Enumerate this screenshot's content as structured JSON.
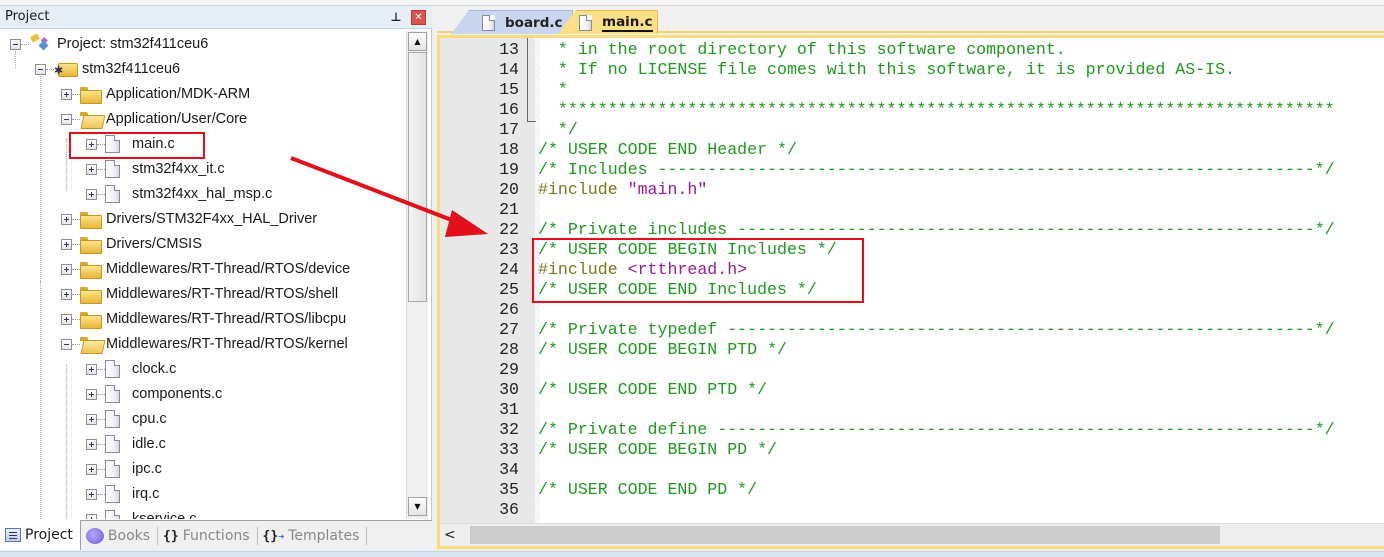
{
  "project_panel": {
    "title": "Project",
    "pin_icon": "pin-icon",
    "close_icon": "close-icon",
    "tree": [
      {
        "label": "Project: stm32f411ceu6",
        "level": 0,
        "type": "project",
        "expanded": true
      },
      {
        "label": "stm32f411ceu6",
        "level": 1,
        "type": "target",
        "expanded": true
      },
      {
        "label": "Application/MDK-ARM",
        "level": 2,
        "type": "folder",
        "expanded": false
      },
      {
        "label": "Application/User/Core",
        "level": 2,
        "type": "folder",
        "expanded": true
      },
      {
        "label": "main.c",
        "level": 3,
        "type": "file",
        "highlighted": true
      },
      {
        "label": "stm32f4xx_it.c",
        "level": 3,
        "type": "file"
      },
      {
        "label": "stm32f4xx_hal_msp.c",
        "level": 3,
        "type": "file"
      },
      {
        "label": "Drivers/STM32F4xx_HAL_Driver",
        "level": 2,
        "type": "folder",
        "expanded": false
      },
      {
        "label": "Drivers/CMSIS",
        "level": 2,
        "type": "folder",
        "expanded": false
      },
      {
        "label": "Middlewares/RT-Thread/RTOS/device",
        "level": 2,
        "type": "folder",
        "expanded": false
      },
      {
        "label": "Middlewares/RT-Thread/RTOS/shell",
        "level": 2,
        "type": "folder",
        "expanded": false
      },
      {
        "label": "Middlewares/RT-Thread/RTOS/libcpu",
        "level": 2,
        "type": "folder",
        "expanded": false
      },
      {
        "label": "Middlewares/RT-Thread/RTOS/kernel",
        "level": 2,
        "type": "folder",
        "expanded": true
      },
      {
        "label": "clock.c",
        "level": 3,
        "type": "file"
      },
      {
        "label": "components.c",
        "level": 3,
        "type": "file"
      },
      {
        "label": "cpu.c",
        "level": 3,
        "type": "file"
      },
      {
        "label": "idle.c",
        "level": 3,
        "type": "file"
      },
      {
        "label": "ipc.c",
        "level": 3,
        "type": "file"
      },
      {
        "label": "irq.c",
        "level": 3,
        "type": "file"
      },
      {
        "label": "kservice.c",
        "level": 3,
        "type": "file"
      }
    ],
    "tabs": [
      {
        "label": "Project",
        "icon": "project-icon",
        "active": true
      },
      {
        "label": "Books",
        "icon": "books-icon",
        "active": false
      },
      {
        "label": "Functions",
        "icon": "functions-icon",
        "active": false
      },
      {
        "label": "Templates",
        "icon": "templates-icon",
        "active": false
      }
    ]
  },
  "editor": {
    "tabs": [
      {
        "label": "board.c",
        "active": false
      },
      {
        "label": "main.c",
        "active": true
      }
    ],
    "lines": [
      {
        "n": "13",
        "parts": [
          {
            "t": "  * in the root directory of this software component.",
            "c": "cm"
          }
        ]
      },
      {
        "n": "14",
        "parts": [
          {
            "t": "  * If no LICENSE file comes with this software, it is provided AS-IS.",
            "c": "cm"
          }
        ]
      },
      {
        "n": "15",
        "parts": [
          {
            "t": "  *",
            "c": "cm"
          }
        ]
      },
      {
        "n": "16",
        "parts": [
          {
            "t": "  ******************************************************************************",
            "c": "cm"
          }
        ]
      },
      {
        "n": "17",
        "parts": [
          {
            "t": "  */",
            "c": "cm"
          }
        ]
      },
      {
        "n": "18",
        "parts": [
          {
            "t": "/* USER CODE END Header */",
            "c": "cm"
          }
        ]
      },
      {
        "n": "19",
        "parts": [
          {
            "t": "/* Includes ------------------------------------------------------------------*/",
            "c": "cm"
          }
        ]
      },
      {
        "n": "20",
        "parts": [
          {
            "t": "#include ",
            "c": "pp"
          },
          {
            "t": "\"main.h\"",
            "c": "str"
          }
        ]
      },
      {
        "n": "21",
        "parts": []
      },
      {
        "n": "22",
        "parts": [
          {
            "t": "/* Private includes ----------------------------------------------------------*/",
            "c": "cm"
          }
        ]
      },
      {
        "n": "23",
        "parts": [
          {
            "t": "/* USER CODE BEGIN Includes */",
            "c": "cm"
          }
        ]
      },
      {
        "n": "24",
        "parts": [
          {
            "t": "#include ",
            "c": "pp"
          },
          {
            "t": "<rtthread.h>",
            "c": "str"
          }
        ]
      },
      {
        "n": "25",
        "parts": [
          {
            "t": "/* USER CODE END Includes */",
            "c": "cm"
          }
        ]
      },
      {
        "n": "26",
        "parts": []
      },
      {
        "n": "27",
        "parts": [
          {
            "t": "/* Private typedef -----------------------------------------------------------*/",
            "c": "cm"
          }
        ]
      },
      {
        "n": "28",
        "parts": [
          {
            "t": "/* USER CODE BEGIN PTD */",
            "c": "cm"
          }
        ]
      },
      {
        "n": "29",
        "parts": []
      },
      {
        "n": "30",
        "parts": [
          {
            "t": "/* USER CODE END PTD */",
            "c": "cm"
          }
        ]
      },
      {
        "n": "31",
        "parts": []
      },
      {
        "n": "32",
        "parts": [
          {
            "t": "/* Private define ------------------------------------------------------------*/",
            "c": "cm"
          }
        ]
      },
      {
        "n": "33",
        "parts": [
          {
            "t": "/* USER CODE BEGIN PD */",
            "c": "cm"
          }
        ]
      },
      {
        "n": "34",
        "parts": []
      },
      {
        "n": "35",
        "parts": [
          {
            "t": "/* USER CODE END PD */",
            "c": "cm"
          }
        ]
      },
      {
        "n": "36",
        "parts": []
      }
    ],
    "scroll_left_icon": "chevron-left-icon"
  },
  "annotations": {
    "highlight_color": "#e3101c",
    "highlighted_tree_item": "main.c",
    "highlighted_code_lines": [
      "23",
      "24",
      "25"
    ],
    "arrow": "from main.c tree item to code lines 23-25"
  },
  "colors": {
    "comment": "#1f9a1f",
    "preprocessor": "#7a7a1a",
    "string": "#9a1a9a",
    "active_tab": "#fddf86",
    "inactive_tab": "#c9d6ef",
    "gutter": "#e8e8e8"
  }
}
